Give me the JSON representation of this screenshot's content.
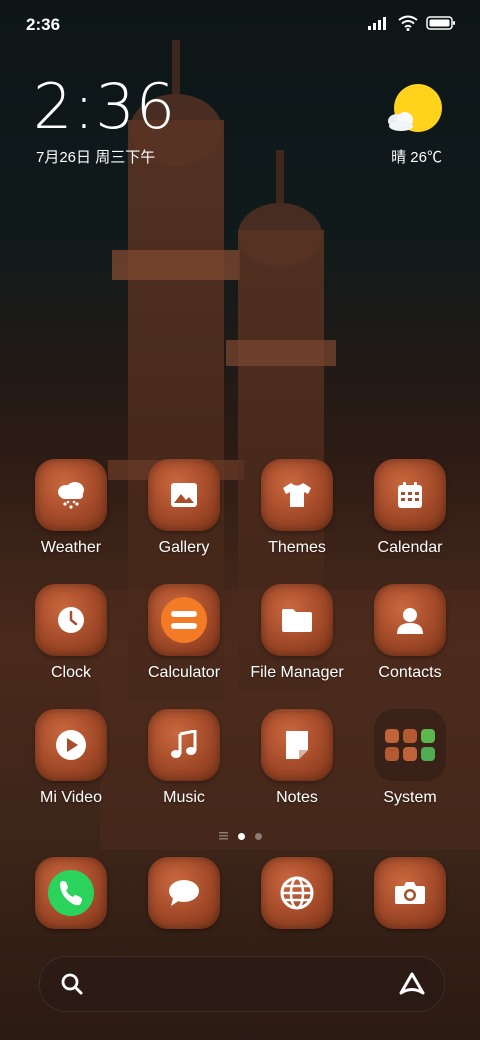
{
  "status_bar": {
    "time": "2:36",
    "icons": [
      "signal-icon",
      "wifi-icon",
      "battery-icon"
    ]
  },
  "clock_widget": {
    "time": "2:36",
    "date": "7月26日 周三下午"
  },
  "weather_widget": {
    "text": "晴 26℃",
    "icon": "sun-cloud-icon"
  },
  "apps": [
    {
      "label": "Weather",
      "icon": "cloud-snow-icon"
    },
    {
      "label": "Gallery",
      "icon": "image-icon"
    },
    {
      "label": "Themes",
      "icon": "tshirt-icon"
    },
    {
      "label": "Calendar",
      "icon": "calendar-icon"
    },
    {
      "label": "Clock",
      "icon": "clock-icon"
    },
    {
      "label": "Calculator",
      "icon": "calculator-icon"
    },
    {
      "label": "File Manager",
      "icon": "folder-icon"
    },
    {
      "label": "Contacts",
      "icon": "person-icon"
    },
    {
      "label": "Mi Video",
      "icon": "play-icon"
    },
    {
      "label": "Music",
      "icon": "music-note-icon"
    },
    {
      "label": "Notes",
      "icon": "note-icon"
    },
    {
      "label": "System",
      "icon": "folder-grid-icon"
    }
  ],
  "dock": [
    {
      "icon": "phone-icon"
    },
    {
      "icon": "message-icon"
    },
    {
      "icon": "globe-icon"
    },
    {
      "icon": "camera-icon"
    }
  ],
  "pager": {
    "pages": 2,
    "current": 1
  },
  "search_bar": {
    "icons": [
      "search-icon",
      "assistant-icon"
    ]
  }
}
